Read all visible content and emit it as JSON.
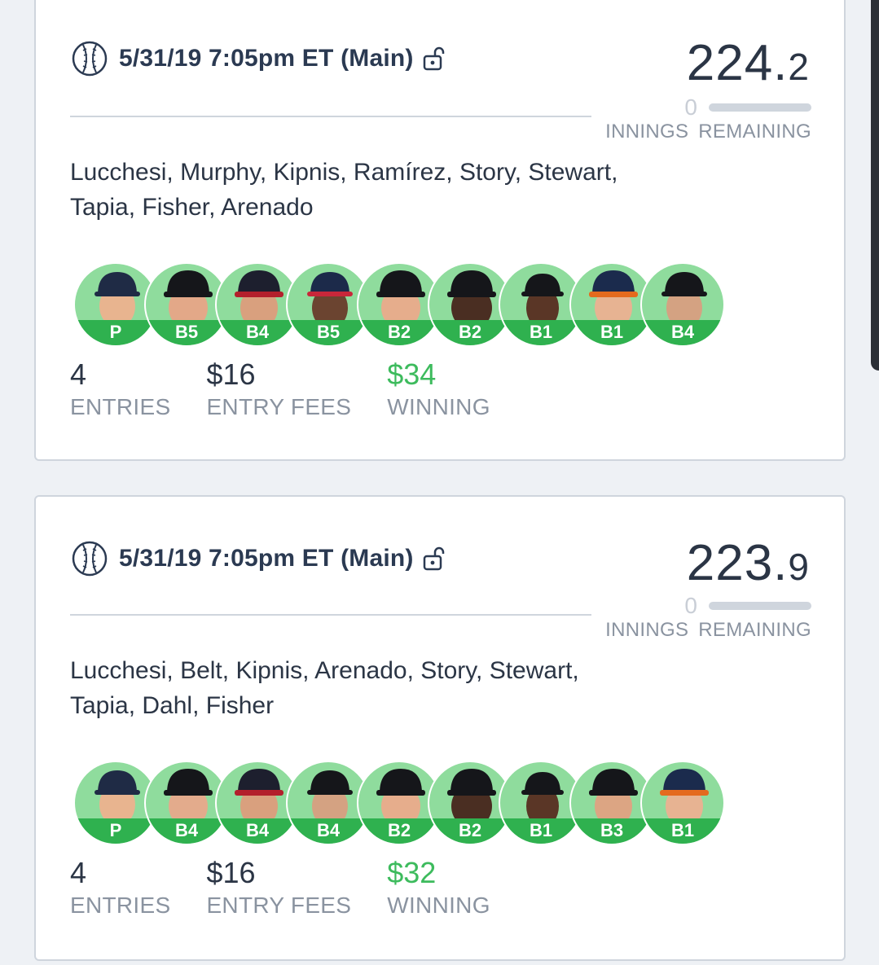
{
  "cards": [
    {
      "title": "5/31/19 7:05pm ET (Main)",
      "score_int": "224.",
      "score_dec": "2",
      "innings_count": "0",
      "innings_label_1": "INNINGS",
      "innings_label_2": "REMAINING",
      "players": "Lucchesi, Murphy, Kipnis, Ramírez, Story, Stewart, Tapia, Fisher, Arenado",
      "positions": [
        "P",
        "B5",
        "B4",
        "B5",
        "B2",
        "B2",
        "B1",
        "B1",
        "B4"
      ],
      "entries": "4",
      "entries_label": "ENTRIES",
      "fees": "$16",
      "fees_label": "ENTRY FEES",
      "winning": "$34",
      "winning_label": "WINNING"
    },
    {
      "title": "5/31/19 7:05pm ET (Main)",
      "score_int": "223.",
      "score_dec": "9",
      "innings_count": "0",
      "innings_label_1": "INNINGS",
      "innings_label_2": "REMAINING",
      "players": "Lucchesi, Belt, Kipnis, Arenado, Story, Stewart, Tapia, Dahl, Fisher",
      "positions": [
        "P",
        "B4",
        "B4",
        "B4",
        "B2",
        "B2",
        "B1",
        "B3",
        "B1"
      ],
      "entries": "4",
      "entries_label": "ENTRIES",
      "fees": "$16",
      "fees_label": "ENTRY FEES",
      "winning": "$32",
      "winning_label": "WINNING"
    }
  ],
  "colors": {
    "accent_green": "#2fb14f",
    "avatar_bg": "#8fdc9d",
    "winning_text": "#3dbb5d"
  },
  "icons": {
    "header": "baseball-icon",
    "lock": "unlocked-lock-icon"
  }
}
